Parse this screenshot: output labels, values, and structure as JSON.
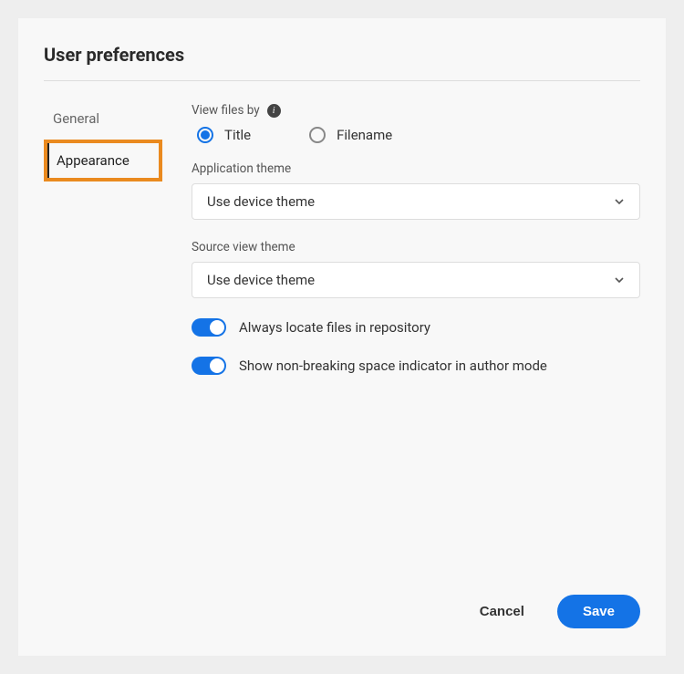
{
  "title": "User preferences",
  "tabs": {
    "general": "General",
    "appearance": "Appearance"
  },
  "viewFilesBy": {
    "label": "View files by",
    "options": {
      "title": "Title",
      "filename": "Filename"
    },
    "selected": "title"
  },
  "appTheme": {
    "label": "Application theme",
    "value": "Use device theme"
  },
  "sourceTheme": {
    "label": "Source view theme",
    "value": "Use device theme"
  },
  "toggles": {
    "locateFiles": {
      "label": "Always locate files in repository",
      "on": true
    },
    "nbsp": {
      "label": "Show non-breaking space indicator in author mode",
      "on": true
    }
  },
  "buttons": {
    "cancel": "Cancel",
    "save": "Save"
  }
}
